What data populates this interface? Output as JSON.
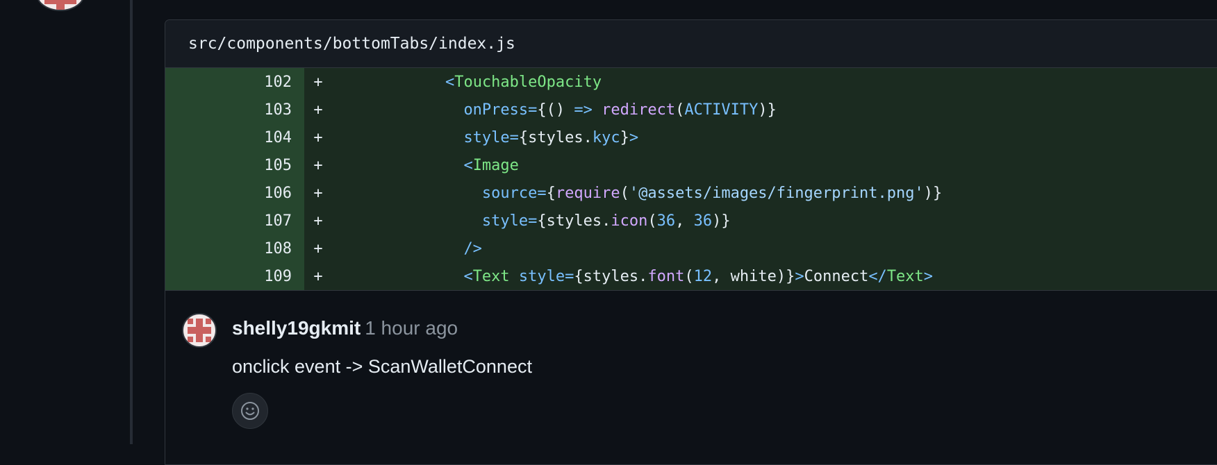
{
  "file": {
    "path": "src/components/bottomTabs/index.js"
  },
  "diff": {
    "lines": [
      {
        "num": "102",
        "marker": "+"
      },
      {
        "num": "103",
        "marker": "+"
      },
      {
        "num": "104",
        "marker": "+"
      },
      {
        "num": "105",
        "marker": "+"
      },
      {
        "num": "106",
        "marker": "+"
      },
      {
        "num": "107",
        "marker": "+"
      },
      {
        "num": "108",
        "marker": "+"
      },
      {
        "num": "109",
        "marker": "+"
      }
    ],
    "code": {
      "l102": {
        "open": "<",
        "tag": "TouchableOpacity"
      },
      "l103": {
        "attr": "onPress",
        "eq": "=",
        "brace": "{",
        "parens": "() ",
        "arrow": "=>",
        "fn": " redirect",
        "lp": "(",
        "arg": "ACTIVITY",
        "rp": ")",
        "close": "}"
      },
      "l104": {
        "attr": "style",
        "eq": "=",
        "brace": "{",
        "obj": "styles.",
        "prop": "kyc",
        "close": "}",
        "gt": ">"
      },
      "l105": {
        "open": "<",
        "tag": "Image"
      },
      "l106": {
        "attr": "source",
        "eq": "=",
        "brace": "{",
        "fn": "require",
        "lp": "(",
        "str": "'@assets/images/fingerprint.png'",
        "rp": ")",
        "close": "}"
      },
      "l107": {
        "attr": "style",
        "eq": "=",
        "brace": "{",
        "obj": "styles.",
        "fn": "icon",
        "lp": "(",
        "n1": "36",
        "comma": ", ",
        "n2": "36",
        "rp": ")",
        "close": "}"
      },
      "l108": {
        "selfclose": "/>"
      },
      "l109": {
        "open": "<",
        "tag": "Text",
        "attr": " style",
        "eq": "=",
        "brace": "{",
        "obj": "styles.",
        "fn": "font",
        "lp": "(",
        "n1": "12",
        "comma": ", ",
        "arg": "white",
        "rp": ")",
        "close": "}",
        "gt": ">",
        "text": "Connect",
        "endopen": "</",
        "endtag": "Text",
        "endgt": ">"
      }
    }
  },
  "comment": {
    "author": "shelly19gkmit",
    "time": "1 hour ago",
    "body": "onclick event -> ScanWalletConnect"
  },
  "icons": {
    "avatar": "identicon",
    "reaction": "smiley-icon"
  },
  "colors": {
    "background": "#0d1117",
    "addition_bg": "#1b2b20",
    "addition_num_bg": "#26462e",
    "tag": "#7ee787",
    "attr": "#79c0ff",
    "function": "#d2a8ff",
    "string": "#a5d6ff",
    "muted": "#8b949e"
  }
}
